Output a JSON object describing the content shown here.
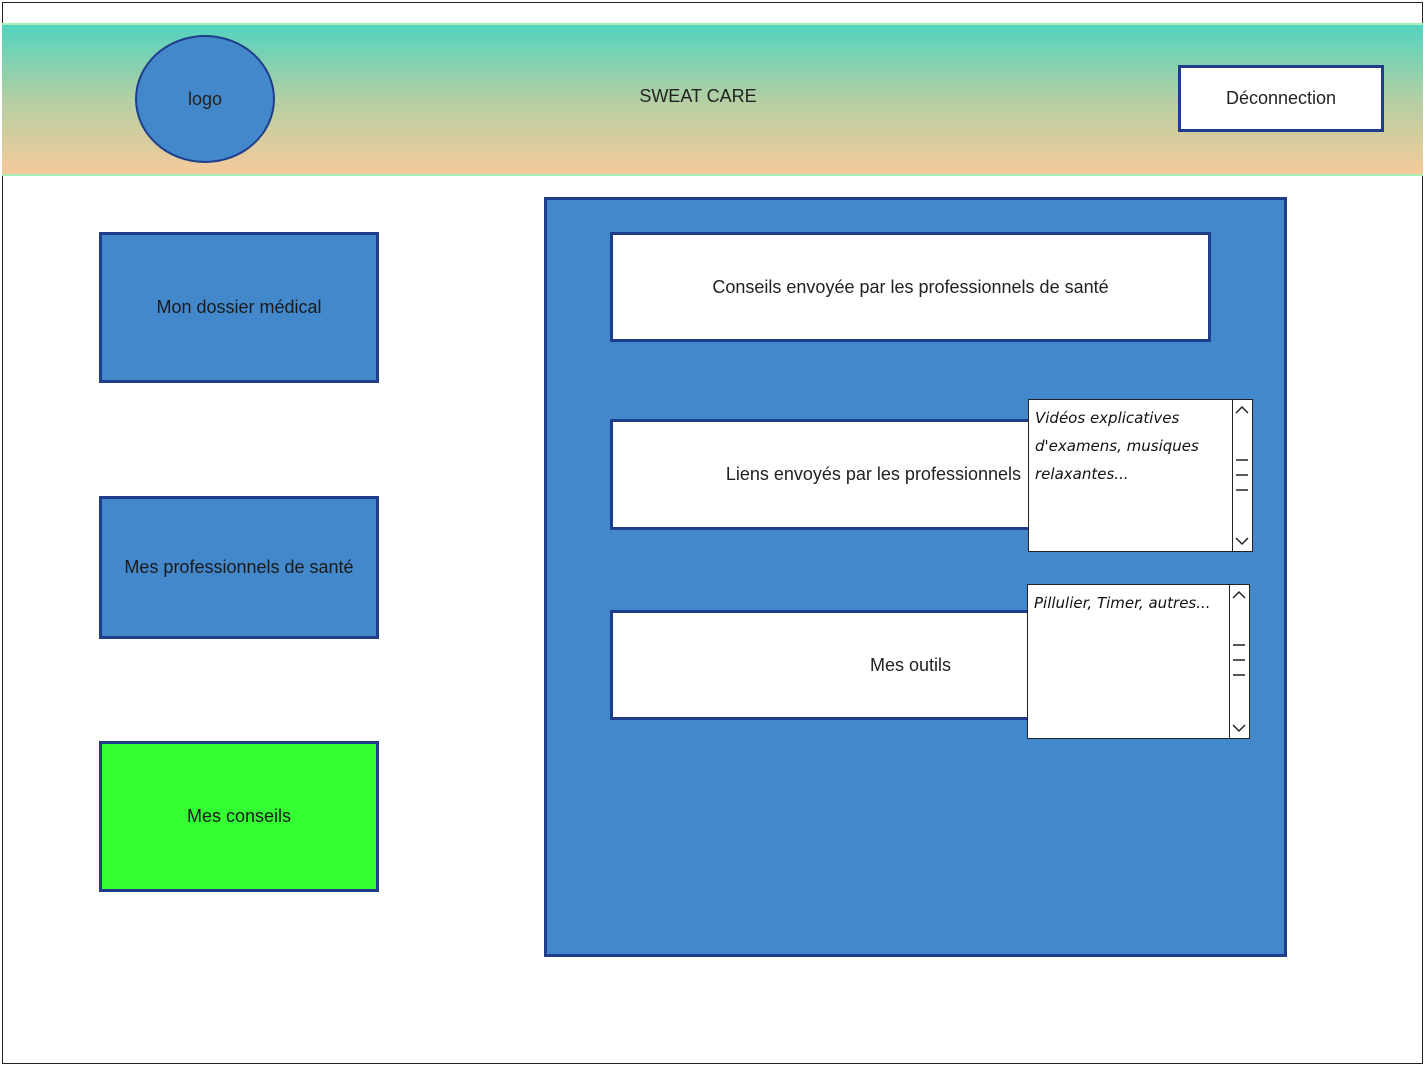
{
  "header": {
    "logo_label": "logo",
    "app_title": "SWEAT CARE",
    "logout_label": "Déconnection"
  },
  "sidebar": {
    "items": [
      {
        "label": "Mon dossier médical",
        "active": false
      },
      {
        "label": "Mes professionnels de santé",
        "active": false
      },
      {
        "label": "Mes conseils",
        "active": true
      }
    ]
  },
  "main": {
    "cards": [
      {
        "label": "Conseils envoyée par les professionnels de santé"
      },
      {
        "label": "Liens envoyés par les professionnels"
      },
      {
        "label": "Mes outils"
      }
    ],
    "listboxes": [
      {
        "lines": [
          "Vidéos explicatives",
          "d'examens, musiques",
          "relaxantes..."
        ]
      },
      {
        "lines": [
          "Pillulier, Timer, autres..."
        ]
      }
    ]
  },
  "colors": {
    "primary_blue": "#4488cc",
    "border_navy": "#1f3d8a",
    "active_green": "#33ff33",
    "header_top": "#52d3bf",
    "header_bottom": "#f5ca9b"
  }
}
